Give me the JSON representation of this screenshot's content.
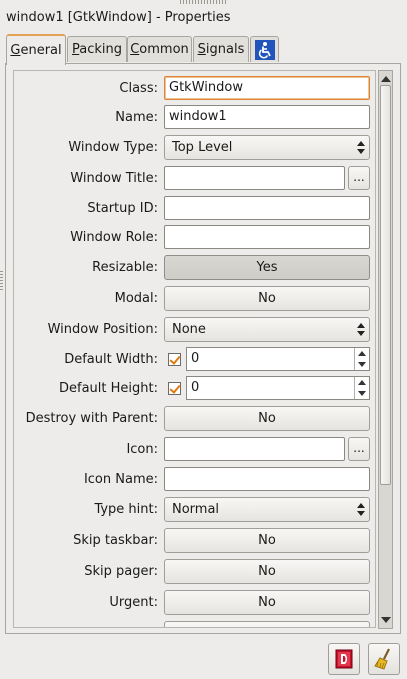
{
  "window": {
    "title": "window1 [GtkWindow] - Properties"
  },
  "tabs": [
    {
      "label_underlined": "G",
      "label_rest": "eneral"
    },
    {
      "label_underlined": "P",
      "label_rest": "acking"
    },
    {
      "label_underlined": "C",
      "label_rest": "ommon"
    },
    {
      "label_underlined": "S",
      "label_rest": "ignals"
    }
  ],
  "fields": {
    "class": {
      "label": "Class:",
      "value": "GtkWindow"
    },
    "name": {
      "label": "Name:",
      "value": "window1"
    },
    "window_type": {
      "label": "Window Type:",
      "value": "Top Level"
    },
    "window_title": {
      "label": "Window Title:",
      "value": ""
    },
    "startup_id": {
      "label": "Startup ID:",
      "value": ""
    },
    "window_role": {
      "label": "Window Role:",
      "value": ""
    },
    "resizable": {
      "label": "Resizable:",
      "value": "Yes"
    },
    "modal": {
      "label": "Modal:",
      "value": "No"
    },
    "window_position": {
      "label": "Window Position:",
      "value": "None"
    },
    "default_width": {
      "label": "Default Width:",
      "value": "0"
    },
    "default_height": {
      "label": "Default Height:",
      "value": "0"
    },
    "destroy_with_parent": {
      "label": "Destroy with Parent:",
      "value": "No"
    },
    "icon": {
      "label": "Icon:",
      "value": ""
    },
    "icon_name": {
      "label": "Icon Name:",
      "value": ""
    },
    "type_hint": {
      "label": "Type hint:",
      "value": "Normal"
    },
    "skip_taskbar": {
      "label": "Skip taskbar:",
      "value": "No"
    },
    "skip_pager": {
      "label": "Skip pager:",
      "value": "No"
    },
    "urgent": {
      "label": "Urgent:",
      "value": "No"
    }
  },
  "ellipsis": "...",
  "icons": {
    "accessibility_tab": "accessibility-icon",
    "docs": "devhelp-icon",
    "clear": "broom-icon"
  },
  "colors": {
    "focus_border": "#d9843a",
    "check": "#e07a10",
    "docs_red": "#c8102e"
  }
}
